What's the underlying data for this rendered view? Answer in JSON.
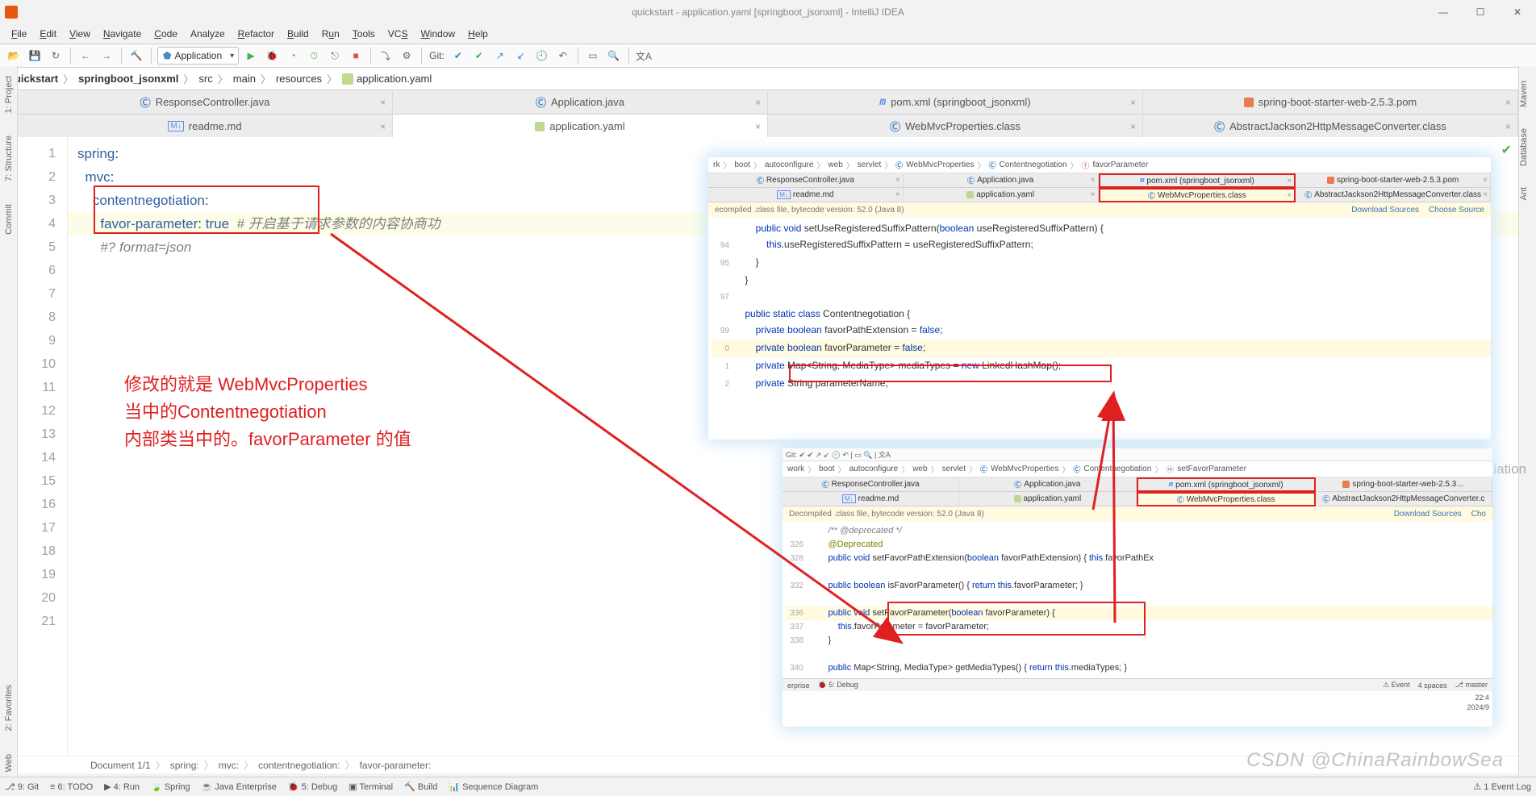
{
  "window": {
    "title": "quickstart - application.yaml [springboot_jsonxml] - IntelliJ IDEA"
  },
  "menu": {
    "file": "File",
    "edit": "Edit",
    "view": "View",
    "navigate": "Navigate",
    "code": "Code",
    "analyze": "Analyze",
    "refactor": "Refactor",
    "build": "Build",
    "run": "Run",
    "tools": "Tools",
    "vcs": "VCS",
    "window": "Window",
    "help": "Help"
  },
  "toolbar": {
    "config": "Application",
    "git_label": "Git:"
  },
  "breadcrumbs": [
    "quickstart",
    "springboot_jsonxml",
    "src",
    "main",
    "resources",
    "application.yaml"
  ],
  "tab_row_1": [
    {
      "icon": "c",
      "label": "ResponseController.java"
    },
    {
      "icon": "c",
      "label": "Application.java"
    },
    {
      "icon": "m",
      "label": "pom.xml (springboot_jsonxml)"
    },
    {
      "icon": "p",
      "label": "spring-boot-starter-web-2.5.3.pom"
    }
  ],
  "tab_row_2": [
    {
      "icon": "md",
      "label": "readme.md"
    },
    {
      "icon": "y",
      "label": "application.yaml",
      "active": true
    },
    {
      "icon": "c",
      "label": "WebMvcProperties.class"
    },
    {
      "icon": "c",
      "label": "AbstractJackson2HttpMessageConverter.class"
    }
  ],
  "left_tools": [
    "1: Project",
    "7: Structure",
    "Commit",
    "2: Favorites",
    "Web"
  ],
  "right_tools": [
    "Maven",
    "Database",
    "Ant"
  ],
  "gutter_lines": [
    "1",
    "2",
    "3",
    "4",
    "5",
    "6",
    "7",
    "8",
    "9",
    "10",
    "11",
    "12",
    "13",
    "14",
    "15",
    "16",
    "17",
    "18",
    "19",
    "20",
    "21"
  ],
  "code": {
    "l1_k": "spring",
    "l1_c": ":",
    "l2_k": "mvc",
    "l2_c": ":",
    "l3_k": "contentnegotiation",
    "l3_c": ":",
    "l4_k": "favor-parameter",
    "l4_c": ": ",
    "l4_v": "true",
    "l4_cm": "#  开启基于请求参数的内容协商功",
    "l5_cm": "#? format=json"
  },
  "annotation": {
    "line1": "修改的就是 WebMvcProperties",
    "line2": "当中的Contentnegotiation",
    "line3": "内部类当中的。favorParameter 的值"
  },
  "overlay1": {
    "crumbs": [
      "rk",
      "boot",
      "autoconfigure",
      "web",
      "servlet",
      "WebMvcProperties",
      "Contentnegotiation",
      "favorParameter"
    ],
    "tab_row_1": [
      {
        "icon": "c",
        "label": "ResponseController.java"
      },
      {
        "icon": "c",
        "label": "Application.java"
      },
      {
        "icon": "m",
        "label": "pom.xml (springboot_jsonxml)"
      },
      {
        "icon": "p",
        "label": "spring-boot-starter-web-2.5.3.pom"
      }
    ],
    "tab_row_2": [
      {
        "icon": "md",
        "label": "readme.md"
      },
      {
        "icon": "y",
        "label": "application.yaml"
      },
      {
        "icon": "c",
        "label": "WebMvcProperties.class",
        "active": true
      },
      {
        "icon": "c",
        "label": "AbstractJackson2HttpMessageConverter.class"
      }
    ],
    "banner_left": "ecompiled .class file, bytecode version: 52.0 (Java 8)",
    "banner_dl": "Download Sources",
    "banner_cs": "Choose Source",
    "lines": [
      {
        "n": "",
        "t": "        public void setUseRegisteredSuffixPattern(boolean useRegisteredSuffixPattern) {"
      },
      {
        "n": "94",
        "t": "            this.useRegisteredSuffixPattern = useRegisteredSuffixPattern;"
      },
      {
        "n": "95",
        "t": "        }"
      },
      {
        "n": "",
        "t": "    }"
      },
      {
        "n": "97",
        "t": ""
      },
      {
        "n": "",
        "t": "    public static class Contentnegotiation {"
      },
      {
        "n": "99",
        "t": "        private boolean favorPathExtension = false;"
      },
      {
        "n": "0",
        "t": "        private boolean favorParameter = false;",
        "hl": true
      },
      {
        "n": "1",
        "t": "        private Map<String, MediaType> mediaTypes = new LinkedHashMap();"
      },
      {
        "n": "2",
        "t": "        private String parameterName;"
      }
    ]
  },
  "overlay2": {
    "crumbs": [
      "work",
      "boot",
      "autoconfigure",
      "web",
      "servlet",
      "WebMvcProperties",
      "Contentnegotiation",
      "setFavorParameter"
    ],
    "tab_row_1": [
      {
        "icon": "c",
        "label": "ResponseController.java"
      },
      {
        "icon": "c",
        "label": "Application.java"
      },
      {
        "icon": "m",
        "label": "pom.xml (springboot_jsonxml)"
      },
      {
        "icon": "p",
        "label": "spring-boot-starter-web-2.5.3…"
      }
    ],
    "tab_row_2": [
      {
        "icon": "md",
        "label": "readme.md"
      },
      {
        "icon": "y",
        "label": "application.yaml"
      },
      {
        "icon": "c",
        "label": "WebMvcProperties.class",
        "active": true
      },
      {
        "icon": "c",
        "label": "AbstractJackson2HttpMessageConverter.c"
      }
    ],
    "banner_left": "Decompiled .class file, bytecode version: 52.0 (Java 8)",
    "banner_dl": "Download Sources",
    "banner_cs": "Cho",
    "lines": [
      {
        "n": "",
        "t": "        /** @deprecated */"
      },
      {
        "n": "326",
        "t": "        @Deprecated"
      },
      {
        "n": "328",
        "t": "        public void setFavorPathExtension(boolean favorPathExtension) { this.favorPathEx"
      },
      {
        "n": "",
        "t": ""
      },
      {
        "n": "332",
        "t": "        public boolean isFavorParameter() { return this.favorParameter; }"
      },
      {
        "n": "",
        "t": ""
      },
      {
        "n": "336",
        "t": "        public void setFavorParameter(boolean favorParameter) {",
        "hl": true
      },
      {
        "n": "337",
        "t": "            this.favorParameter = favorParameter;"
      },
      {
        "n": "338",
        "t": "        }"
      },
      {
        "n": "",
        "t": ""
      },
      {
        "n": "340",
        "t": "        public Map<String, MediaType> getMediaTypes() { return this.mediaTypes; }"
      }
    ],
    "bottom_tools": [
      "erprise",
      "5: Debug"
    ],
    "status_right": [
      "Event",
      "4 spaces",
      "master",
      "22:4",
      "2024/9"
    ]
  },
  "hint_negotiation": "negotiation",
  "bottom_crumbs": {
    "doc": "Document 1/1",
    "items": [
      "spring:",
      "mvc:",
      "contentnegotiation:",
      "favor-parameter:"
    ]
  },
  "bottom_tools": [
    "9: Git",
    "6: TODO",
    "4: Run",
    "Spring",
    "Java Enterprise",
    "5: Debug",
    "Terminal",
    "Build",
    "Sequence Diagram"
  ],
  "bottom_right": "1 Event Log",
  "watermark": "CSDN @ChinaRainbowSea"
}
